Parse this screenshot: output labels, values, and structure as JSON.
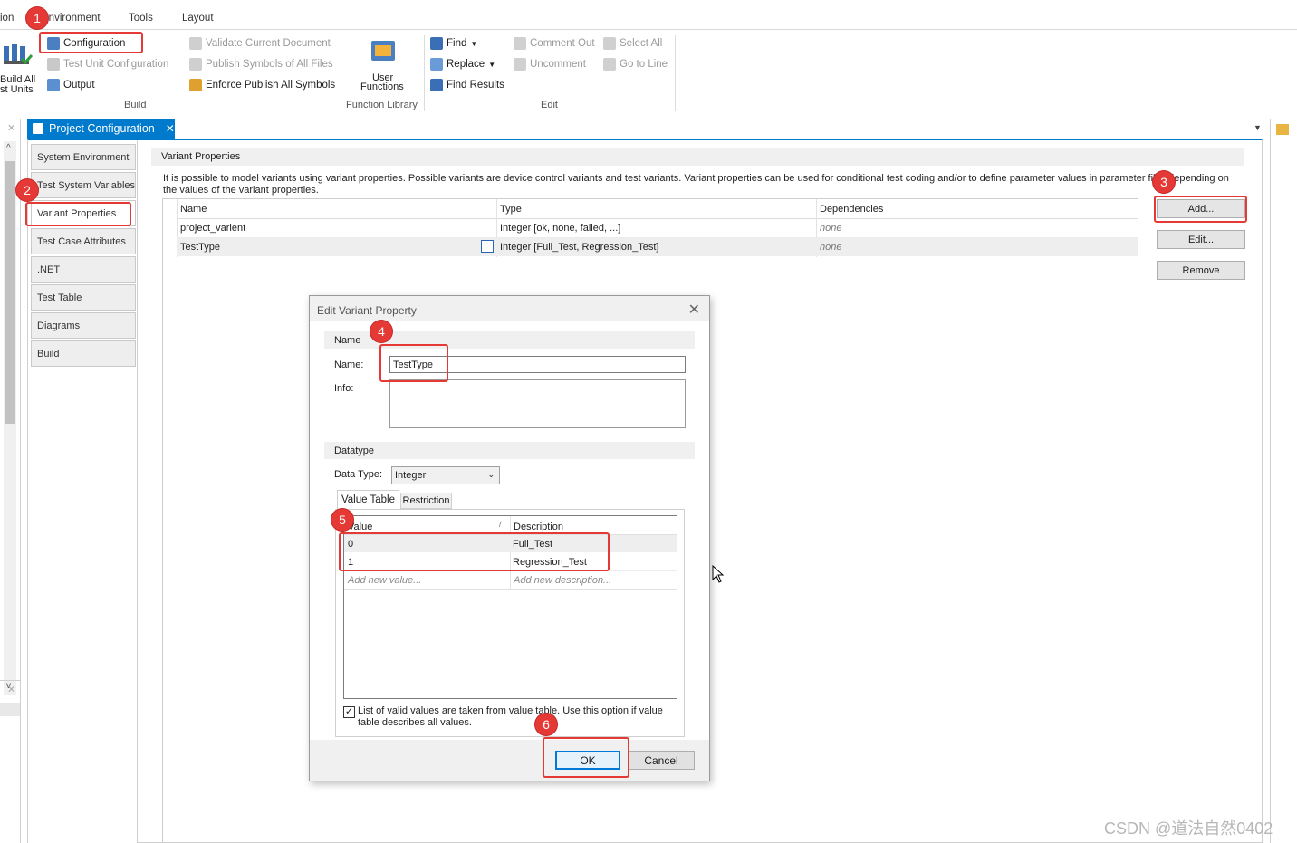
{
  "menu": {
    "items": [
      "ion",
      "Environment",
      "Tools",
      "Layout"
    ]
  },
  "ribbon": {
    "build_all_label_1": "Build All",
    "build_all_label_2": "st Units",
    "configuration": "Configuration",
    "test_unit_configuration": "Test Unit Configuration",
    "output": "Output",
    "validate_current_document": "Validate Current Document",
    "publish_symbols": "Publish Symbols of All Files",
    "enforce_publish": "Enforce Publish All Symbols",
    "group_build": "Build",
    "user_functions_1": "User",
    "user_functions_2": "Functions",
    "group_function_library": "Function Library",
    "find": "Find",
    "replace": "Replace",
    "find_results": "Find Results",
    "comment_out": "Comment Out",
    "uncomment": "Uncomment",
    "select_all": "Select All",
    "go_to_line": "Go to Line",
    "group_edit": "Edit"
  },
  "doc_tab": {
    "title": "Project Configuration",
    "close": "✕"
  },
  "nav": {
    "items": [
      "System Environment",
      "Test System Variables",
      "Variant Properties",
      "Test Case Attributes",
      ".NET",
      "Test Table",
      "Diagrams",
      "Build"
    ]
  },
  "variant": {
    "header": "Variant Properties",
    "description": "It is possible to model variants using variant properties. Possible variants are device control variants and test variants. Variant properties can be used for conditional test coding and/or to define parameter values in parameter files depending on the values of the variant properties.",
    "columns": [
      "Name",
      "Type",
      "Dependencies"
    ],
    "rows": [
      {
        "name": "project_varient",
        "type": "Integer [ok, none, failed, ...]",
        "deps": "none"
      },
      {
        "name": "TestType",
        "type": "Integer [Full_Test, Regression_Test]",
        "deps": "none"
      }
    ],
    "btn_add": "Add...",
    "btn_edit": "Edit...",
    "btn_remove": "Remove"
  },
  "dialog": {
    "title": "Edit Variant Property",
    "section_name": "Name",
    "name_label": "Name:",
    "name_value": "TestType",
    "info_label": "Info:",
    "section_datatype": "Datatype",
    "datatype_label": "Data Type:",
    "datatype_value": "Integer",
    "tab_value_table": "Value Table",
    "tab_restriction": "Restriction",
    "col_value": "Value",
    "col_description": "Description",
    "values": [
      {
        "value": "0",
        "description": "Full_Test"
      },
      {
        "value": "1",
        "description": "Regression_Test"
      }
    ],
    "add_value_placeholder": "Add new value...",
    "add_desc_placeholder": "Add new description...",
    "checkbox_label": "List of valid values are taken from value table. Use this option if value table describes all values.",
    "btn_ok": "OK",
    "btn_cancel": "Cancel"
  },
  "annotations": [
    "1",
    "2",
    "3",
    "4",
    "5",
    "6"
  ],
  "watermark": "CSDN @道法自然0402",
  "colors": {
    "accent": "#007acc",
    "annotation_red": "#e53935"
  }
}
